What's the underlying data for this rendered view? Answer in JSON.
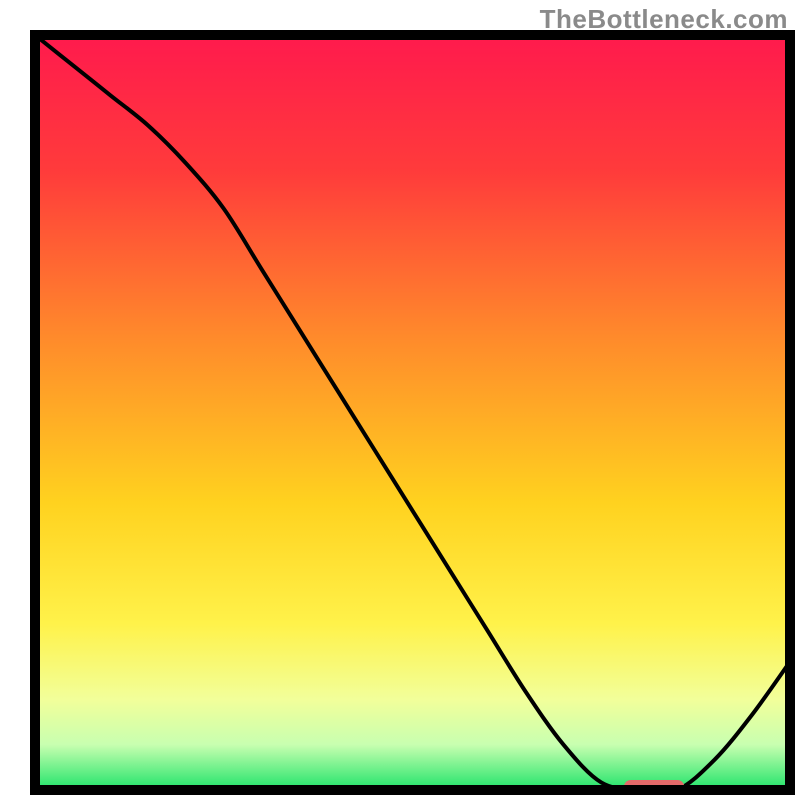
{
  "watermark": "TheBottleneck.com",
  "chart_data": {
    "type": "line",
    "title": "",
    "xlabel": "",
    "ylabel": "",
    "xlim": [
      0,
      100
    ],
    "ylim": [
      0,
      100
    ],
    "x": [
      0,
      5,
      10,
      15,
      20,
      25,
      30,
      35,
      40,
      45,
      50,
      55,
      60,
      65,
      70,
      75,
      80,
      85,
      90,
      95,
      100
    ],
    "values": [
      100,
      96,
      92,
      88,
      83,
      77,
      69,
      61,
      53,
      45,
      37,
      29,
      21,
      13,
      6,
      1,
      0,
      0,
      4,
      10,
      17
    ],
    "marker": {
      "x_start": 78,
      "x_end": 86,
      "y": 0
    },
    "gradient_stops": [
      {
        "offset": 0,
        "color": "#ff1a4d"
      },
      {
        "offset": 18,
        "color": "#ff3b3b"
      },
      {
        "offset": 40,
        "color": "#ff8a2b"
      },
      {
        "offset": 62,
        "color": "#ffd21f"
      },
      {
        "offset": 78,
        "color": "#fff24a"
      },
      {
        "offset": 88,
        "color": "#f2ff9a"
      },
      {
        "offset": 94,
        "color": "#c8ffb0"
      },
      {
        "offset": 100,
        "color": "#20e36a"
      }
    ],
    "curve_color": "#000000",
    "marker_color": "#e46a6a",
    "frame_stroke": "#000000",
    "frame_stroke_width": 10
  }
}
